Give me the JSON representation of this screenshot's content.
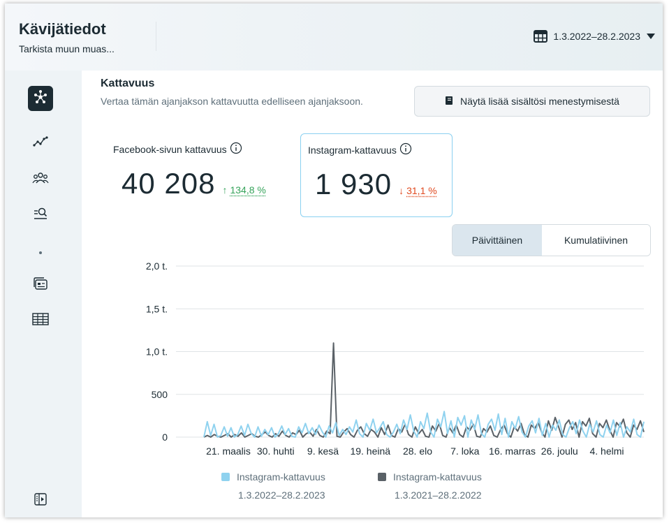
{
  "header": {
    "title": "Kävijätiedot",
    "subtitle": "Tarkista muun muas...",
    "date_range": "1.3.2022–28.2.2023"
  },
  "sidebar": {
    "items": [
      {
        "icon": "overview-icon",
        "active": true
      },
      {
        "icon": "trend-icon",
        "active": false
      },
      {
        "icon": "audience-icon",
        "active": false
      },
      {
        "icon": "content-search-icon",
        "active": false
      },
      {
        "icon": "dot-icon",
        "active": false
      },
      {
        "icon": "cards-icon",
        "active": false
      },
      {
        "icon": "table-icon",
        "active": false
      },
      {
        "icon": "collapse-icon",
        "active": false
      }
    ]
  },
  "section": {
    "title": "Kattavuus",
    "description": "Vertaa tämän ajanjakson kattavuutta edelliseen ajanjaksoon.",
    "more_button": "Näytä lisää sisältösi menestymisestä"
  },
  "metrics": {
    "facebook": {
      "label": "Facebook-sivun kattavuus",
      "value": "40 208",
      "delta_arrow": "↑",
      "delta": "134,8 %",
      "direction": "up"
    },
    "instagram": {
      "label": "Instagram-kattavuus",
      "value": "1 930",
      "delta_arrow": "↓",
      "delta": "31,1 %",
      "direction": "down"
    }
  },
  "toggle": {
    "daily": "Päivittäinen",
    "cumulative": "Kumulatiivinen",
    "selected": "daily"
  },
  "colors": {
    "current": "#8fd2ef",
    "previous": "#5a6167",
    "up": "#35a35a",
    "down": "#e0491f",
    "accent_border": "#8ad0f0"
  },
  "chart_data": {
    "type": "line",
    "y_ticks": [
      "0",
      "500",
      "1,0 t.",
      "1,5 t.",
      "2,0 t."
    ],
    "y_tick_values": [
      0,
      500,
      1000,
      1500,
      2000
    ],
    "ylim": [
      0,
      2000
    ],
    "x_ticks": [
      "21. maalis",
      "30. huhti",
      "9. kesä",
      "19. heinä",
      "28. elo",
      "7. loka",
      "16. marras",
      "26. joulu",
      "4. helmi"
    ],
    "grid": true,
    "series": [
      {
        "name": "Instagram-kattavuus",
        "range": "1.3.2022–28.2.2023",
        "color": "#8fd2ef",
        "values": [
          0,
          180,
          20,
          150,
          0,
          20,
          120,
          10,
          110,
          0,
          30,
          130,
          20,
          150,
          40,
          0,
          120,
          10,
          90,
          30,
          110,
          0,
          40,
          130,
          30,
          100,
          10,
          0,
          120,
          50,
          160,
          40,
          110,
          30,
          140,
          60,
          0,
          130,
          50,
          170,
          20,
          90,
          30,
          120,
          60,
          200,
          40,
          0,
          160,
          80,
          210,
          50,
          110,
          180,
          30,
          0,
          60,
          150,
          40,
          200,
          90,
          260,
          70,
          0,
          180,
          100,
          280,
          60,
          0,
          210,
          120,
          300,
          40,
          190,
          0,
          230,
          140,
          250,
          0,
          200,
          90,
          260,
          40,
          0,
          150,
          210,
          80,
          270,
          30,
          220,
          0,
          180,
          100,
          240,
          60,
          0,
          130,
          190,
          50,
          220,
          20,
          160,
          0,
          140,
          80,
          200,
          30,
          0,
          110,
          180,
          40,
          200,
          70,
          0,
          150,
          60,
          190,
          30,
          0,
          140,
          50,
          200,
          20,
          170,
          0,
          120,
          60,
          210,
          30,
          0,
          180
        ]
      },
      {
        "name": "Instagram-kattavuus",
        "range": "1.3.2021–28.2.2022",
        "color": "#5a6167",
        "values": [
          0,
          20,
          0,
          30,
          10,
          0,
          20,
          40,
          0,
          30,
          10,
          50,
          0,
          20,
          40,
          10,
          0,
          30,
          60,
          20,
          0,
          40,
          10,
          70,
          20,
          0,
          50,
          30,
          80,
          0,
          40,
          60,
          10,
          90,
          20,
          0,
          70,
          40,
          1100,
          10,
          0,
          60,
          100,
          30,
          0,
          80,
          120,
          40,
          10,
          90,
          60,
          0,
          110,
          30,
          140,
          20,
          0,
          100,
          60,
          150,
          30,
          0,
          120,
          40,
          90,
          10,
          0,
          130,
          70,
          160,
          20,
          0,
          110,
          50,
          140,
          30,
          0,
          120,
          80,
          150,
          10,
          0,
          100,
          60,
          130,
          20,
          0,
          90,
          140,
          40,
          0,
          120,
          70,
          160,
          30,
          0,
          140,
          100,
          170,
          60,
          0,
          190,
          80,
          230,
          120,
          0,
          150,
          200,
          90,
          170,
          0,
          180,
          130,
          220,
          40,
          0,
          160,
          110,
          200,
          80,
          0,
          170,
          120,
          210,
          50,
          0,
          140,
          90,
          190,
          60
        ]
      }
    ]
  }
}
